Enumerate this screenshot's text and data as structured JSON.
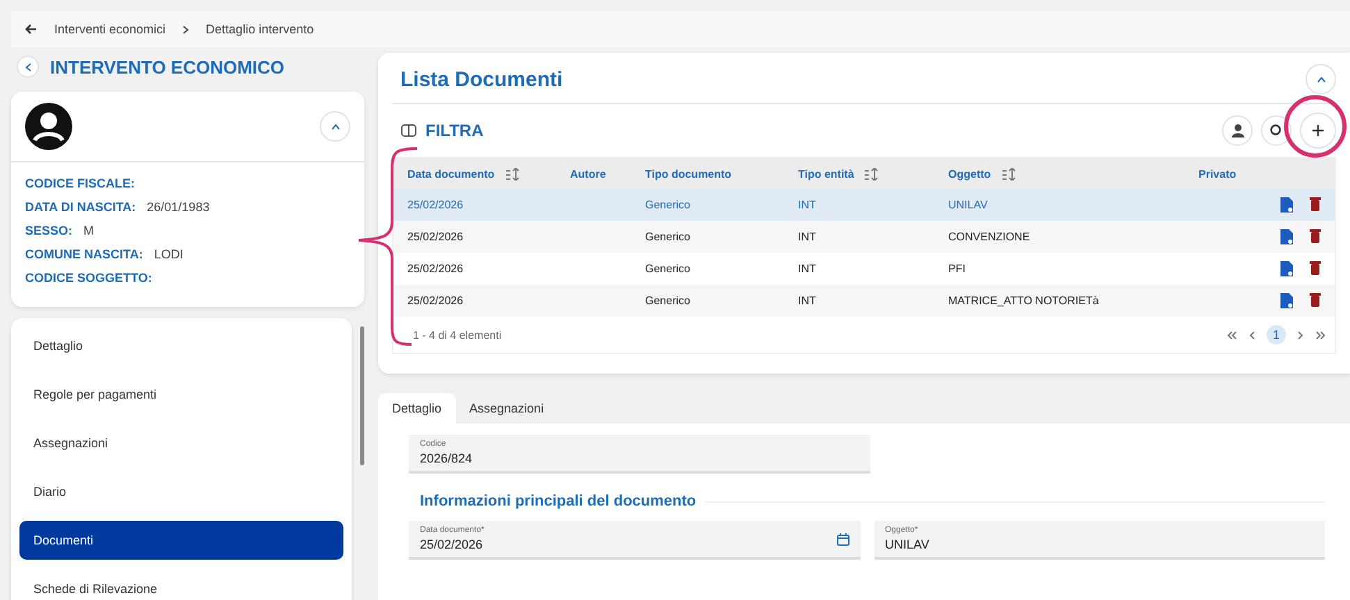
{
  "breadcrumb": [
    "Interventi economici",
    "Dettaglio intervento"
  ],
  "sidebar": {
    "title": "INTERVENTO ECONOMICO",
    "profile": {
      "fields": [
        {
          "label": "CODICE FISCALE:"
        },
        {
          "label": "DATA DI NASCITA:",
          "value": "26/01/1983"
        },
        {
          "label": "SESSO:",
          "value": "M"
        },
        {
          "label": "COMUNE NASCITA:",
          "value": "LODI"
        },
        {
          "label": "CODICE SOGGETTO:"
        }
      ]
    },
    "items": [
      {
        "label": "Dettaglio",
        "selected": false
      },
      {
        "label": "Regole per pagamenti",
        "selected": false
      },
      {
        "label": "Assegnazioni",
        "selected": false
      },
      {
        "label": "Diario",
        "selected": false
      },
      {
        "label": "Documenti",
        "selected": true
      },
      {
        "label": "Schede di Rilevazione",
        "selected": false
      }
    ]
  },
  "documents": {
    "title": "Lista Documenti",
    "filter_label": "FILTRA",
    "columns": [
      {
        "label": "Data documento",
        "sortable": true
      },
      {
        "label": "Autore",
        "sortable": false
      },
      {
        "label": "Tipo documento",
        "sortable": false
      },
      {
        "label": "Tipo entità",
        "sortable": true
      },
      {
        "label": "Oggetto",
        "sortable": true
      },
      {
        "label": "Privato",
        "sortable": false
      }
    ],
    "rows": [
      {
        "cells": [
          "25/02/2026",
          "",
          "Generico",
          "INT",
          "UNILAV",
          ""
        ],
        "selected": true
      },
      {
        "cells": [
          "25/02/2026",
          "",
          "Generico",
          "INT",
          "CONVENZIONE",
          ""
        ],
        "selected": false
      },
      {
        "cells": [
          "25/02/2026",
          "",
          "Generico",
          "INT",
          "PFI",
          ""
        ],
        "selected": false
      },
      {
        "cells": [
          "25/02/2026",
          "",
          "Generico",
          "INT",
          "MATRICE_ATTO NOTORIETà",
          ""
        ],
        "selected": false
      }
    ],
    "summary": "1 - 4 di 4 elementi",
    "current_page": "1"
  },
  "detail": {
    "tabs": [
      {
        "label": "Dettaglio",
        "selected": true
      },
      {
        "label": "Assegnazioni",
        "selected": false
      }
    ],
    "code_field": {
      "label": "Codice",
      "value": "2026/824"
    },
    "section_title": "Informazioni principali del documento",
    "fields": [
      {
        "label": "Data documento*",
        "value": "25/02/2026",
        "kind": "date"
      },
      {
        "label": "Oggetto*",
        "value": "UNILAV",
        "kind": "text"
      }
    ]
  }
}
